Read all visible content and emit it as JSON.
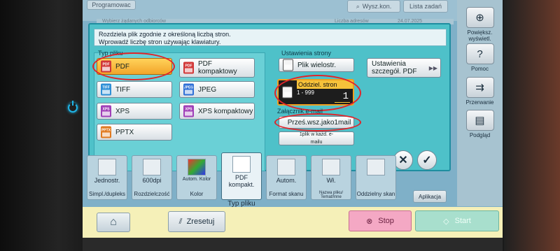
{
  "top": {
    "programs_label": "Programowac",
    "search_label": "Wysz.kon.",
    "jobs_label": "Lista zadań",
    "stripe_left": "Wybierz żądanych odbiorców",
    "stripe_right": "Liczba adresów",
    "stripe_date": "24.07.2025"
  },
  "sidebar": {
    "zoom_label": "Powiększ. wyświetl.",
    "help_label": "Pomoc",
    "forward_label": "Przerwanie",
    "preview_label": "Podgląd"
  },
  "dialog": {
    "message_line1": "Rozdziela plik zgodnie z określoną liczbą stron.",
    "message_line2": "Wprowadź liczbę stron używając klawiatury.",
    "file_type_label": "Typ pliku",
    "file_types": [
      {
        "label": "PDF",
        "icon": "PDF",
        "color": "#d13838",
        "selected": true
      },
      {
        "label": "PDF kompaktowy",
        "icon": "PDF",
        "color": "#d13838",
        "selected": false
      },
      {
        "label": "TIFF",
        "icon": "TIFF",
        "color": "#2f8fd6",
        "selected": false
      },
      {
        "label": "JPEG",
        "icon": "JPEG",
        "color": "#2f6fd6",
        "selected": false
      },
      {
        "label": "XPS",
        "icon": "XPS",
        "color": "#a040b8",
        "selected": false
      },
      {
        "label": "XPS kompaktowy",
        "icon": "XPS",
        "color": "#a040b8",
        "selected": false
      },
      {
        "label": "PPTX",
        "icon": "PPTX",
        "color": "#e07a20",
        "selected": false
      }
    ],
    "page_settings_label": "Ustawienia strony",
    "multi_page_label": "Plik wielostr.",
    "separate_pages_label": "Oddziel. stron",
    "separate_pages_range": "1 - 999",
    "separate_pages_value": "1",
    "attachment_label": "Załącznik e-mail",
    "send_all_label": "Prześ.wsz.jako1mail",
    "one_file_label": "1plik w każd. e-mailu",
    "detail_settings_label": "Ustawienia szczegół. PDF",
    "cancel_symbol": "✕",
    "ok_symbol": "✓"
  },
  "tabs": [
    {
      "value": "Jednostr.",
      "caption": "Simpl./dupleks"
    },
    {
      "value": "600dpi",
      "caption": "Rozdzielczość"
    },
    {
      "value": "Autom. Kolor",
      "caption": "Kolor"
    },
    {
      "value": "PDF kompakt.",
      "caption": "Typ pliku"
    },
    {
      "value": "Autom.",
      "caption": "Format skanu"
    },
    {
      "value": "Wł.",
      "caption": "Nazwa pliku/ Temat/Inne"
    },
    {
      "value": "",
      "caption": "Oddzielny skan"
    }
  ],
  "apps_label": "Aplikacja",
  "actionbar": {
    "reset_label": "Zresetuj",
    "stop_label": "Stop",
    "start_label": "Start"
  },
  "colors": {
    "dialog_bg": "#4ec1c9",
    "selected": "#f2a52a",
    "annotation_ring": "#e0242a",
    "stop": "#f4a8c4",
    "start": "#a8dfcd"
  }
}
